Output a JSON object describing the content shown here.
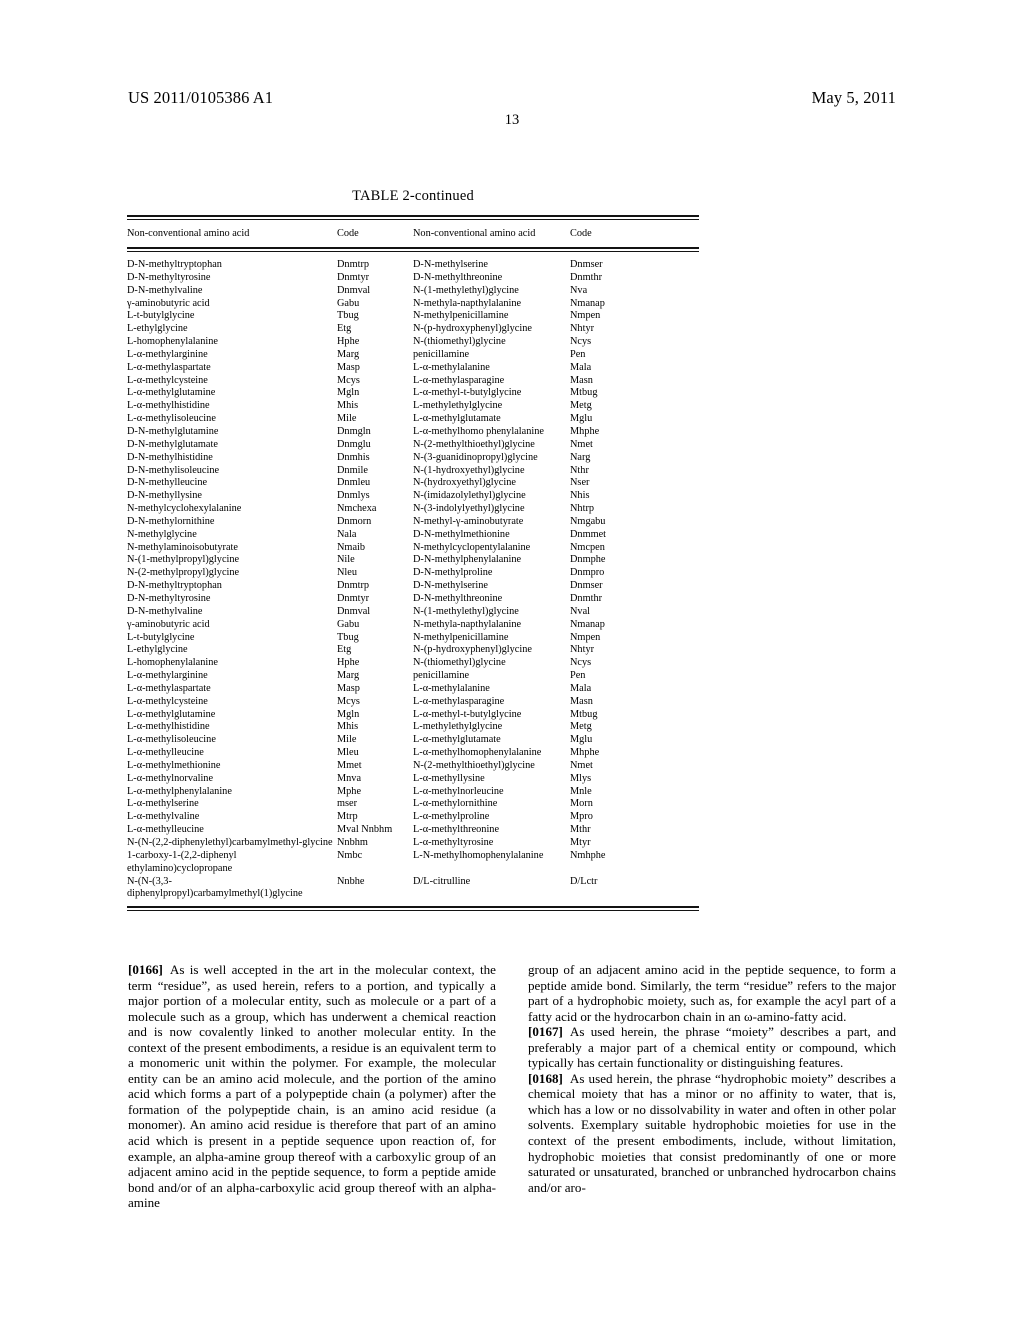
{
  "header": {
    "publication_number": "US 2011/0105386 A1",
    "date": "May 5, 2011",
    "page_number": "13"
  },
  "table": {
    "caption": "TABLE 2-continued",
    "columns": [
      "Non-conventional amino acid",
      "Code",
      "Non-conventional amino acid",
      "Code"
    ],
    "rows": [
      [
        "D-N-methyltryptophan",
        "Dnmtrp",
        "D-N-methylserine",
        "Dnmser"
      ],
      [
        "D-N-methyltyrosine",
        "Dnmtyr",
        "D-N-methylthreonine",
        "Dnmthr"
      ],
      [
        "D-N-methylvaline",
        "Dnmval",
        "N-(1-methylethyl)glycine",
        "Nva"
      ],
      [
        "γ-aminobutyric acid",
        "Gabu",
        "N-methyla-napthylalanine",
        "Nmanap"
      ],
      [
        "L-t-butylglycine",
        "Tbug",
        "N-methylpenicillamine",
        "Nmpen"
      ],
      [
        "L-ethylglycine",
        "Etg",
        "N-(p-hydroxyphenyl)glycine",
        "Nhtyr"
      ],
      [
        "L-homophenylalanine",
        "Hphe",
        "N-(thiomethyl)glycine",
        "Ncys"
      ],
      [
        "L-α-methylarginine",
        "Marg",
        "penicillamine",
        "Pen"
      ],
      [
        "L-α-methylaspartate",
        "Masp",
        "L-α-methylalanine",
        "Mala"
      ],
      [
        "L-α-methylcysteine",
        "Mcys",
        "L-α-methylasparagine",
        "Masn"
      ],
      [
        "L-α-methylglutamine",
        "Mgln",
        "L-α-methyl-t-butylglycine",
        "Mtbug"
      ],
      [
        "L-α-methylhistidine",
        "Mhis",
        "L-methylethylglycine",
        "Metg"
      ],
      [
        "L-α-methylisoleucine",
        "Mile",
        "L-α-methylglutamate",
        "Mglu"
      ],
      [
        "D-N-methylglutamine",
        "Dnmgln",
        "L-α-methylhomo phenylalanine",
        "Mhphe"
      ],
      [
        "D-N-methylglutamate",
        "Dnmglu",
        "N-(2-methylthioethyl)glycine",
        "Nmet"
      ],
      [
        "D-N-methylhistidine",
        "Dnmhis",
        "N-(3-guanidinopropyl)glycine",
        "Narg"
      ],
      [
        "D-N-methylisoleucine",
        "Dnmile",
        "N-(1-hydroxyethyl)glycine",
        "Nthr"
      ],
      [
        "D-N-methylleucine",
        "Dnmleu",
        "N-(hydroxyethyl)glycine",
        "Nser"
      ],
      [
        "D-N-methyllysine",
        "Dnmlys",
        "N-(imidazolylethyl)glycine",
        "Nhis"
      ],
      [
        "N-methylcyclohexylalanine",
        "Nmchexa",
        "N-(3-indolylyethyl)glycine",
        "Nhtrp"
      ],
      [
        "D-N-methylornithine",
        "Dnmorn",
        "N-methyl-γ-aminobutyrate",
        "Nmgabu"
      ],
      [
        "N-methylglycine",
        "Nala",
        "D-N-methylmethionine",
        "Dnmmet"
      ],
      [
        "N-methylaminoisobutyrate",
        "Nmaib",
        "N-methylcyclopentylalanine",
        "Nmcpen"
      ],
      [
        "N-(1-methylpropyl)glycine",
        "Nile",
        "D-N-methylphenylalanine",
        "Dnmphe"
      ],
      [
        "N-(2-methylpropyl)glycine",
        "Nleu",
        "D-N-methylproline",
        "Dnmpro"
      ],
      [
        "D-N-methyltryptophan",
        "Dnmtrp",
        "D-N-methylserine",
        "Dnmser"
      ],
      [
        "D-N-methyltyrosine",
        "Dnmtyr",
        "D-N-methylthreonine",
        "Dnmthr"
      ],
      [
        "D-N-methylvaline",
        "Dnmval",
        "N-(1-methylethyl)glycine",
        "Nval"
      ],
      [
        "γ-aminobutyric acid",
        "Gabu",
        "N-methyla-napthylalanine",
        "Nmanap"
      ],
      [
        "L-t-butylglycine",
        "Tbug",
        "N-methylpenicillamine",
        "Nmpen"
      ],
      [
        "L-ethylglycine",
        "Etg",
        "N-(p-hydroxyphenyl)glycine",
        "Nhtyr"
      ],
      [
        "L-homophenylalanine",
        "Hphe",
        "N-(thiomethyl)glycine",
        "Ncys"
      ],
      [
        "L-α-methylarginine",
        "Marg",
        "penicillamine",
        "Pen"
      ],
      [
        "L-α-methylaspartate",
        "Masp",
        "L-α-methylalanine",
        "Mala"
      ],
      [
        "L-α-methylcysteine",
        "Mcys",
        "L-α-methylasparagine",
        "Masn"
      ],
      [
        "L-α-methylglutamine",
        "Mgln",
        "L-α-methyl-t-butylglycine",
        "Mtbug"
      ],
      [
        "L-α-methylhistidine",
        "Mhis",
        "L-methylethylglycine",
        "Metg"
      ],
      [
        "L-α-methylisoleucine",
        "Mile",
        "L-α-methylglutamate",
        "Mglu"
      ],
      [
        "L-α-methylleucine",
        "Mleu",
        "L-α-methylhomophenylalanine",
        "Mhphe"
      ],
      [
        "L-α-methylmethionine",
        "Mmet",
        "N-(2-methylthioethyl)glycine",
        "Nmet"
      ],
      [
        "L-α-methylnorvaline",
        "Mnva",
        "L-α-methyllysine",
        "Mlys"
      ],
      [
        "L-α-methylphenylalanine",
        "Mphe",
        "L-α-methylnorleucine",
        "Mnle"
      ],
      [
        "L-α-methylserine",
        "mser",
        "L-α-methylornithine",
        "Morn"
      ],
      [
        "L-α-methylvaline",
        "Mtrp",
        "L-α-methylproline",
        "Mpro"
      ],
      [
        "L-α-methylleucine",
        "Mval Nnbhm",
        "L-α-methylthreonine",
        "Mthr"
      ],
      [
        "N-(N-(2,2-diphenylethyl)carbamylmethyl-glycine",
        "Nnbhm",
        "L-α-methyltyrosine",
        "Mtyr"
      ],
      [
        "1-carboxy-1-(2,2-diphenyl ethylamino)cyclopropane",
        "Nmbc",
        "L-N-methylhomophenylalanine",
        "Nmhphe"
      ],
      [
        "N-(N-(3,3-diphenylpropyl)carbamylmethyl(1)glycine",
        "Nnbhe",
        "D/L-citrulline",
        "D/Lctr"
      ]
    ]
  },
  "body": {
    "left_column": [
      {
        "number": "[0166]",
        "text": "As is well accepted in the art in the molecular context, the term “residue”, as used herein, refers to a portion, and typically a major portion of a molecular entity, such as molecule or a part of a molecule such as a group, which has underwent a chemical reaction and is now covalently linked to another molecular entity. In the context of the present embodiments, a residue is an equivalent term to a monomeric unit within the polymer. For example, the molecular entity can be an amino acid molecule, and the portion of the amino acid which forms a part of a polypeptide chain (a polymer) after the formation of the polypeptide chain, is an amino acid residue (a monomer). An amino acid residue is therefore that part of an amino acid which is present in a peptide sequence upon reaction of, for example, an alpha-amine group thereof with a carboxylic group of an adjacent amino acid in the peptide sequence, to form a peptide amide bond and/or of an alpha-carboxylic acid group thereof with an alpha-amine"
      }
    ],
    "right_column": [
      {
        "number": "",
        "text": "group of an adjacent amino acid in the peptide sequence, to form a peptide amide bond. Similarly, the term “residue” refers to the major part of a hydrophobic moiety, such as, for example the acyl part of a fatty acid or the hydrocarbon chain in an ω-amino-fatty acid."
      },
      {
        "number": "[0167]",
        "text": "As used herein, the phrase “moiety” describes a part, and preferably a major part of a chemical entity or compound, which typically has certain functionality or distinguishing features."
      },
      {
        "number": "[0168]",
        "text": "As used herein, the phrase “hydrophobic moiety” describes a chemical moiety that has a minor or no affinity to water, that is, which has a low or no dissolvability in water and often in other polar solvents. Exemplary suitable hydrophobic moieties for use in the context of the present embodiments, include, without limitation, hydrophobic moieties that consist predominantly of one or more saturated or unsaturated, branched or unbranched hydrocarbon chains and/or aro-"
      }
    ]
  }
}
